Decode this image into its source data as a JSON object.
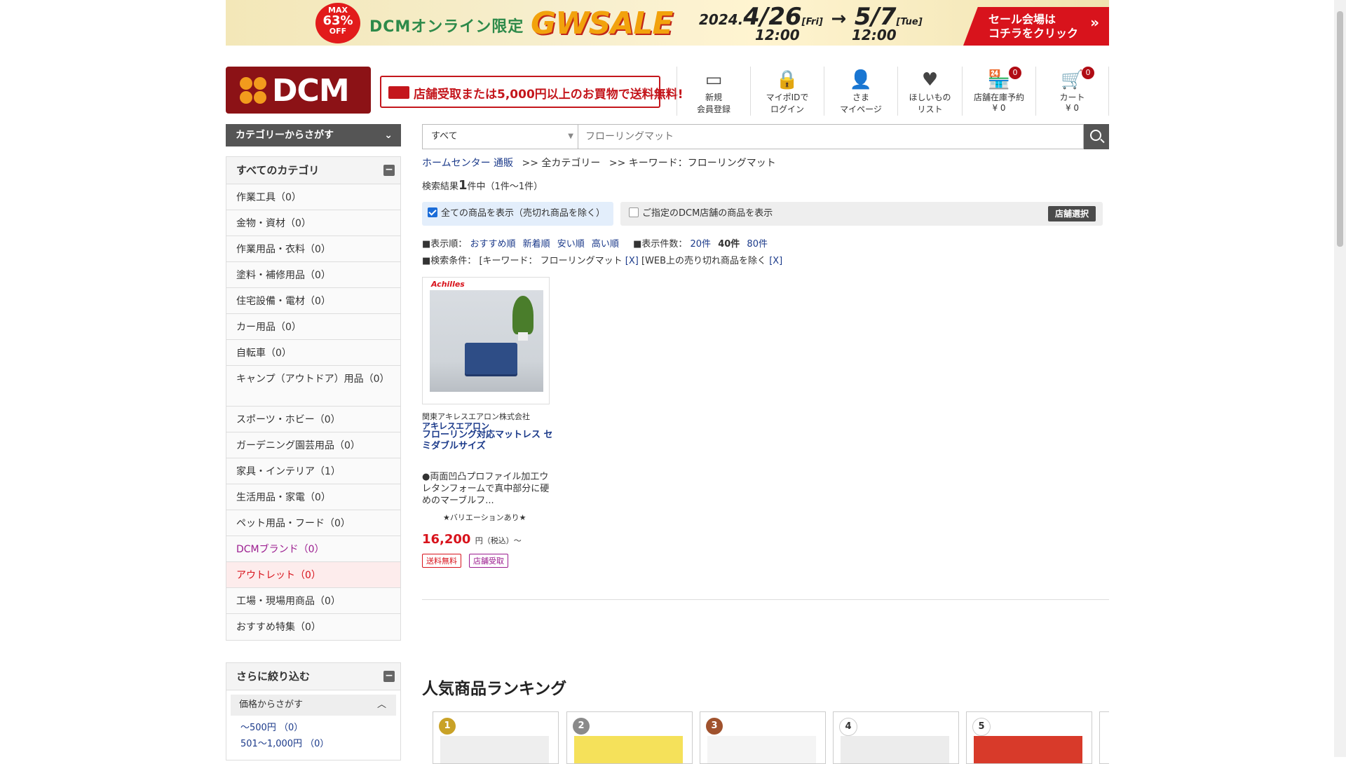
{
  "banner": {
    "max": "MAX",
    "pct": "63%",
    "off": "OFF",
    "online": "DCMオンライン限定",
    "sale": "GWSALE",
    "year": "2024.",
    "start_date": "4/26",
    "start_dow": "[Fri]",
    "start_time": "12:00",
    "end_date": "5/7",
    "end_dow": "[Tue]",
    "end_time": "12:00",
    "cta_line1": "セール会場は",
    "cta_line2": "コチラをクリック",
    "accent": "#d8131c"
  },
  "header": {
    "logo_text": "DCM",
    "shipping": "店舗受取または5,000円以上のお買物で送料無料!",
    "nav": [
      {
        "line1": "新規",
        "line2": "会員登録",
        "icon": "id-card-icon"
      },
      {
        "line1": "マイポIDで",
        "line2": "ログイン",
        "icon": "lock-icon"
      },
      {
        "line1": "さま",
        "line2": "マイページ",
        "icon": "user-icon"
      },
      {
        "line1": "ほしいもの",
        "line2": "リスト",
        "icon": "heart-icon"
      },
      {
        "line1": "店舗在庫予約",
        "line2": "¥ 0",
        "count": "0",
        "icon": "store-icon"
      },
      {
        "line1": "カート",
        "line2": "¥ 0",
        "count": "0",
        "icon": "cart-icon"
      }
    ]
  },
  "search": {
    "category_button": "カテゴリーからさがす",
    "select_value": "すべて",
    "placeholder": "フローリングマット"
  },
  "sidebar": {
    "title": "すべてのカテゴリ",
    "items": [
      "作業工具（0）",
      "金物・資材（0）",
      "作業用品・衣料（0）",
      "塗料・補修用品（0）",
      "住宅設備・電材（0）",
      "カー用品（0）",
      "自転車（0）",
      "キャンプ（アウトドア）用品（0）",
      "スポーツ・ホビー（0）",
      "ガーデニング園芸用品（0）",
      "家具・インテリア（1）",
      "生活用品・家電（0）",
      "ペット用品・フード（0）",
      "DCMブランド（0）",
      "アウトレット（0）",
      "工場・現場用商品（0）",
      "おすすめ特集（0）"
    ],
    "narrow_title": "さらに絞り込む",
    "price_title": "価格からさがす",
    "prices": [
      "～500円 （0）",
      "501～1,000円 （0）"
    ]
  },
  "main": {
    "breadcrumb": [
      "ホームセンター 通販",
      ">> 全カテゴリー",
      ">> キーワード：フローリングマット"
    ],
    "result_prefix": "検索結果",
    "result_count": "1",
    "result_suffix": "件中（1件～1件）",
    "filter_all": "全ての商品を表示（売切れ商品を除く）",
    "filter_store": "ご指定のDCM店舗の商品を表示",
    "store_select": "店舗選択",
    "sort_label": "■表示順：",
    "sort_options": [
      "おすすめ順",
      "新着順",
      "安い順",
      "高い順"
    ],
    "count_label": "■表示件数：",
    "count_options": [
      "20件",
      "40件",
      "80件"
    ],
    "cond_label": "■検索条件：",
    "cond_keyword": "[キーワード： フローリングマット",
    "cond_x": "[X]",
    "cond_web": "[WEB上の売り切れ商品を除く"
  },
  "product": {
    "brand_logo": "Achilles",
    "maker": "関東アキレスエアロン株式会社",
    "brand": "アキレスエアロン",
    "name": "フローリング対応マットレス セミダブルサイズ",
    "desc": "●両面凹凸プロファイル加工ウレタンフォームで真中部分に硬めのマーブルフ...",
    "variation": "★バリエーションあり★",
    "price": "16,200",
    "price_unit": "円（税込）～",
    "tags": [
      "送料無料",
      "店舗受取"
    ]
  },
  "ranking": {
    "title": "人気商品ランキング",
    "ranks": [
      "1",
      "2",
      "3",
      "4",
      "5"
    ],
    "rank_colors": [
      "#c9a227",
      "#8a8a8a",
      "#a0522d",
      "#ffffff",
      "#ffffff"
    ]
  }
}
